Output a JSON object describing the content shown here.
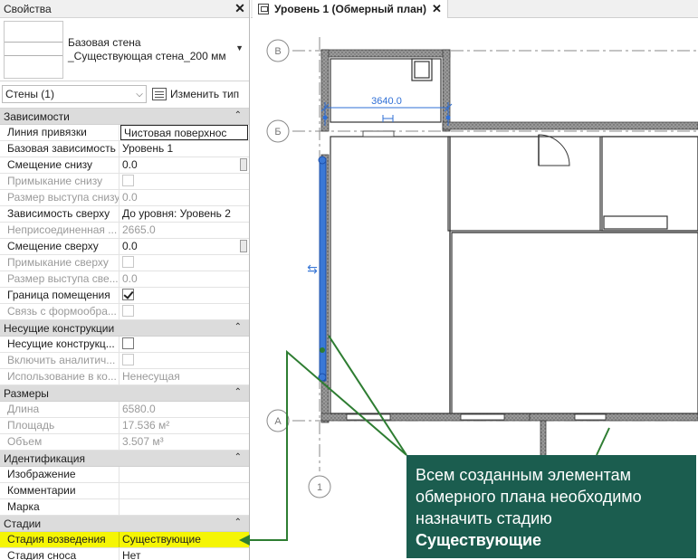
{
  "properties": {
    "title": "Свойства",
    "close": "✕",
    "type_name_line1": "Базовая стена",
    "type_name_line2": "_Существующая стена_200 мм",
    "filter": "Стены (1)",
    "edit_type": "Изменить тип",
    "sections": [
      {
        "name": "Зависимости",
        "rows": [
          {
            "label": "Линия привязки",
            "value": "Чистовая поверхнос"
          },
          {
            "label": "Базовая зависимость",
            "value": "Уровень 1"
          },
          {
            "label": "Смещение снизу",
            "value": "0.0"
          },
          {
            "label": "Примыкание снизу",
            "value": ""
          },
          {
            "label": "Размер выступа снизу",
            "value": "0.0"
          },
          {
            "label": "Зависимость сверху",
            "value": "До уровня: Уровень 2"
          },
          {
            "label": "Неприсоединенная ...",
            "value": "2665.0"
          },
          {
            "label": "Смещение сверху",
            "value": "0.0"
          },
          {
            "label": "Примыкание сверху",
            "value": ""
          },
          {
            "label": "Размер выступа све...",
            "value": "0.0"
          },
          {
            "label": "Граница помещения",
            "value": ""
          },
          {
            "label": "Связь с формообра...",
            "value": ""
          }
        ]
      },
      {
        "name": "Несущие конструкции",
        "rows": [
          {
            "label": "Несущие конструкц...",
            "value": ""
          },
          {
            "label": "Включить аналитич...",
            "value": ""
          },
          {
            "label": "Использование в ко...",
            "value": "Ненесущая"
          }
        ]
      },
      {
        "name": "Размеры",
        "rows": [
          {
            "label": "Длина",
            "value": "6580.0"
          },
          {
            "label": "Площадь",
            "value": "17.536 м²"
          },
          {
            "label": "Объем",
            "value": "3.507 м³"
          }
        ]
      },
      {
        "name": "Идентификация",
        "rows": [
          {
            "label": "Изображение",
            "value": ""
          },
          {
            "label": "Комментарии",
            "value": ""
          },
          {
            "label": "Марка",
            "value": ""
          }
        ]
      },
      {
        "name": "Стадии",
        "rows": [
          {
            "label": "Стадия возведения",
            "value": "Существующие"
          },
          {
            "label": "Стадия сноса",
            "value": "Нет"
          }
        ]
      }
    ]
  },
  "view_tab": {
    "label": "Уровень 1 (Обмерный план)",
    "close": "✕"
  },
  "plan": {
    "grid_b": "В",
    "grid_b2": "Б",
    "grid_a": "А",
    "grid_1": "1",
    "dimension": "3640.0"
  },
  "callout": {
    "line1": "Всем созданным элементам",
    "line2": "обмерного плана необходимо",
    "line3": "назначить стадию",
    "line4": "Существующие"
  },
  "colors": {
    "accent_blue": "#3a78d6",
    "callout_bg": "#1b5d4f",
    "highlight": "#f5f505"
  }
}
